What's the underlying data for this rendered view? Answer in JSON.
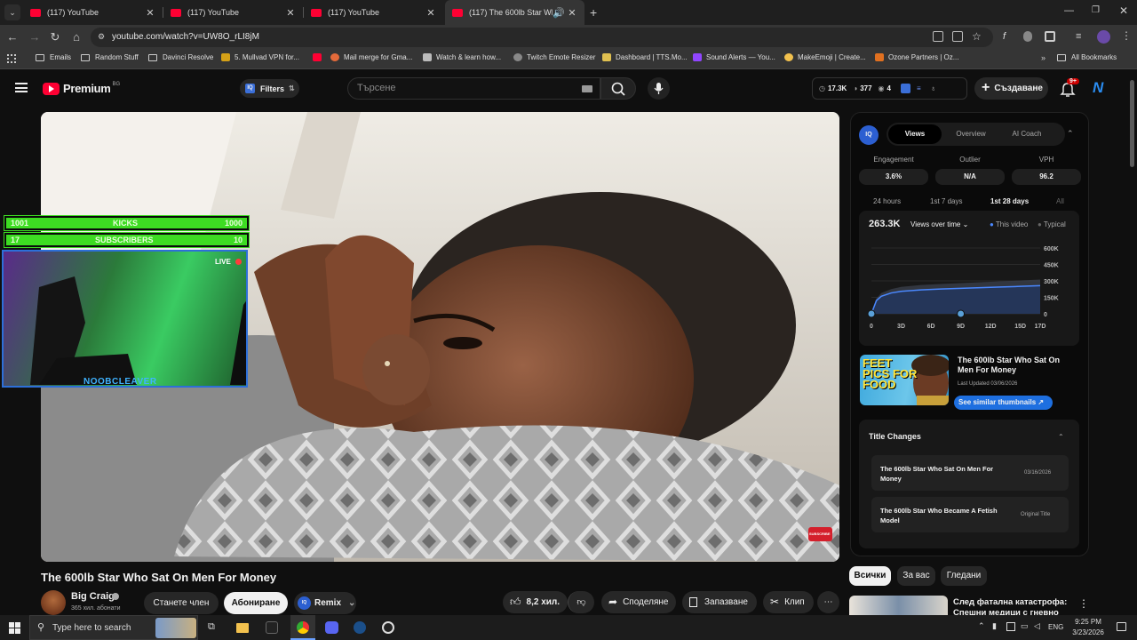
{
  "browser": {
    "tabs": [
      {
        "title": "(117) YouTube"
      },
      {
        "title": "(117) YouTube"
      },
      {
        "title": "(117) YouTube"
      },
      {
        "title": "(117) The 600lb Star Who S"
      }
    ],
    "url": "youtube.com/watch?v=UW8O_rLI8jM",
    "bookmarks": [
      "Emails",
      "Random Stuff",
      "Davinci Resolve",
      "5. Mullvad VPN for...",
      "",
      "Mail merge for Gma...",
      "Watch & learn how...",
      "Twitch Emote Resizer",
      "Dashboard | TTS.Mo...",
      "Sound Alerts — You...",
      "MakeEmoji | Create...",
      "Ozone Partners | Oz..."
    ],
    "all_bookmarks": "All Bookmarks"
  },
  "yt": {
    "logo": "Premium",
    "logo_region": "BG",
    "filters": "Filters",
    "search_placeholder": "Търсене",
    "stats": {
      "views": "17.3K",
      "likes": "377",
      "comments": "4"
    },
    "create": "Създаване",
    "notif_count": "9+"
  },
  "overlay": {
    "kicks": {
      "left": "1001",
      "label": "KICKS",
      "right": "1000"
    },
    "subs": {
      "left": "17",
      "label": "SUBSCRIBERS",
      "right": "10"
    },
    "live": "LIVE",
    "name": "NOOBCLEAVER",
    "subscribe": "SUBSCRIBE"
  },
  "panel": {
    "tabs": [
      "Views",
      "Overview",
      "AI Coach"
    ],
    "metrics": [
      {
        "label": "Engagement",
        "value": "3.6%"
      },
      {
        "label": "Outlier",
        "value": "N/A"
      },
      {
        "label": "VPH",
        "value": "96.2"
      }
    ],
    "ranges": [
      "24 hours",
      "1st 7 days",
      "1st 28 days",
      "All"
    ],
    "total": "263.3K",
    "views_over_time": "Views over time",
    "legend": [
      "This video",
      "Typical"
    ],
    "thumb_title": "The 600lb Star Who Sat On Men For Money",
    "last_updated": "Last Updated 03/06/2026",
    "similar": "See similar thumbnails",
    "title_changes": "Title Changes",
    "changes": [
      {
        "title": "The 600lb Star Who Sat On Men For Money",
        "date": "03/16/2026"
      },
      {
        "title": "The 600lb Star Who Became A Fetish Model",
        "date": "Original Title"
      }
    ],
    "thumb_text": "FEET PICS FOR FOOD"
  },
  "chart_data": {
    "type": "area",
    "x_ticks": [
      "0",
      "3D",
      "6D",
      "9D",
      "12D",
      "15D",
      "17D"
    ],
    "y_ticks": [
      "600K",
      "450K",
      "300K",
      "150K",
      "0"
    ],
    "ylim": [
      0,
      600000
    ],
    "series": [
      {
        "name": "This video",
        "x": [
          0,
          0.5,
          1,
          2,
          3,
          5,
          7,
          9,
          11,
          13,
          15,
          17
        ],
        "values": [
          0,
          120000,
          160000,
          190000,
          205000,
          218000,
          226000,
          232000,
          238000,
          244000,
          250000,
          256000
        ]
      },
      {
        "name": "Typical",
        "x": [
          0,
          0.5,
          1,
          2,
          3,
          5,
          7,
          9,
          11,
          13,
          15,
          17
        ],
        "values": [
          0,
          140000,
          190000,
          225000,
          245000,
          262000,
          272000,
          280000,
          288000,
          296000,
          304000,
          312000
        ]
      }
    ]
  },
  "video": {
    "title": "The 600lb Star Who Sat On Men For Money",
    "channel": "Big Craig",
    "subs": "365 хил. абонати",
    "join": "Станете член",
    "subscribe": "Абониране",
    "remix": "Remix",
    "likes": "8,2 хил.",
    "share": "Споделяне",
    "save": "Запазване",
    "clip": "Клип"
  },
  "chips": [
    "Всички",
    "За вас",
    "Гледани"
  ],
  "next_title": "След фатална катастрофа: Спешни медици с гневно",
  "taskbar": {
    "search": "Type here to search",
    "lang": "ENG",
    "time": "9:25 PM",
    "date": "3/23/2026"
  }
}
